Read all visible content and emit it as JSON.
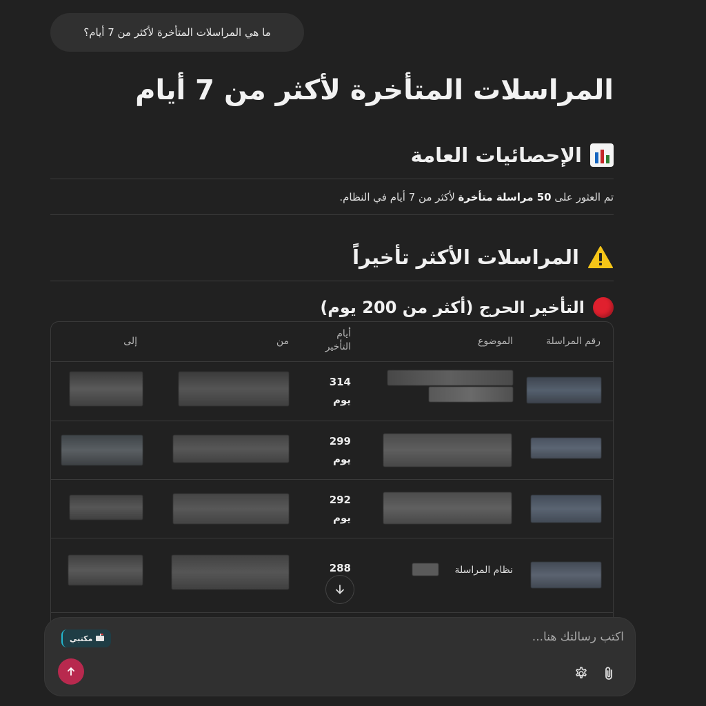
{
  "user_message": "ما هي المراسلات المتأخرة لأكثر من 7 أيام؟",
  "title": "المراسلات المتأخرة لأكثر من 7 أيام",
  "stats_section": {
    "heading": "الإحصائيات العامة",
    "icon": "bar-chart-emoji",
    "text_prefix": "تم العثور على ",
    "count": "50",
    "bold_word": " مراسلة متأخرة",
    "text_suffix": " لأكثر من 7 أيام في النظام."
  },
  "most_delayed_section": {
    "heading": "المراسلات الأكثر تأخيراً",
    "icon": "warning-emoji"
  },
  "critical_section": {
    "heading": "التأخير الحرج (أكثر من 200 يوم)",
    "icon": "red-circle-emoji"
  },
  "table": {
    "headers": {
      "id": "رقم المراسلة",
      "subject": "الموضوع",
      "days_line1": "أيام",
      "days_line2": "التأخير",
      "from": "من",
      "to": "إلى"
    },
    "rows": [
      {
        "days": "314",
        "unit": "يوم",
        "subject": ""
      },
      {
        "days": "299",
        "unit": "يوم",
        "subject": ""
      },
      {
        "days": "292",
        "unit": "يوم",
        "subject": ""
      },
      {
        "days": "288",
        "unit": "",
        "subject": "نظام المراسلة"
      }
    ]
  },
  "composer": {
    "placeholder": "اكتب رسالتك هنا...",
    "chip_label": "مكتبي",
    "chip_icon": "mailbox-icon"
  },
  "colors": {
    "background": "#212121",
    "send_button": "#b8294e",
    "chip_accent": "#22b8cf",
    "critical_red": "#e0202e"
  }
}
